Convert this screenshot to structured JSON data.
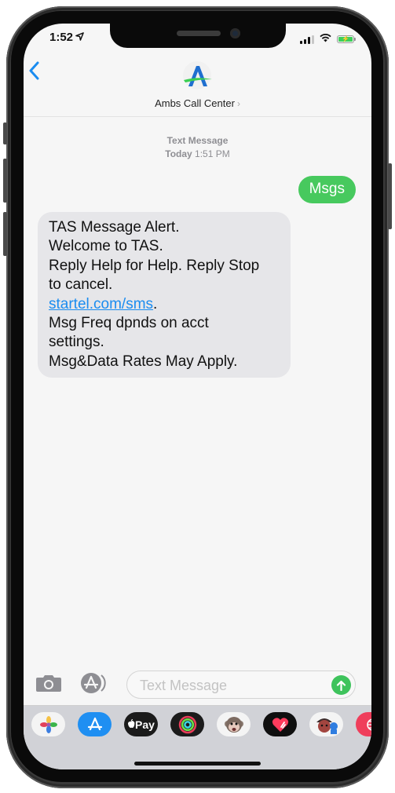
{
  "status_bar": {
    "time": "1:52",
    "location_icon": "location-arrow-icon",
    "signal_icon": "cellular-signal-icon",
    "wifi_icon": "wifi-icon",
    "battery_icon": "battery-charging-icon",
    "battery_charge_glyph": "⚡"
  },
  "header": {
    "back_icon": "chevron-left-icon",
    "back_glyph": "‹",
    "contact_name": "Ambs Call Center",
    "contact_chevron": "›",
    "logo_icon": "ambs-logo-icon"
  },
  "thread": {
    "service_label": "Text Message",
    "date_day": "Today",
    "date_time": "1:51 PM",
    "messages": [
      {
        "direction": "outgoing",
        "text": "Msgs"
      },
      {
        "direction": "incoming",
        "lines": [
          "TAS Message Alert.",
          "Welcome to TAS.",
          "Reply Help for Help. Reply Stop",
          "to cancel."
        ],
        "link_text": "startel.com/sms",
        "link_suffix": ".",
        "lines_after": [
          "Msg Freq dpnds on acct",
          "settings.",
          "Msg&Data Rates May Apply."
        ]
      }
    ]
  },
  "composer": {
    "camera_icon": "camera-icon",
    "apps_icon": "app-store-icon",
    "placeholder": "Text Message",
    "value": "",
    "send_icon": "send-arrow-up-icon"
  },
  "app_tray": {
    "apps": [
      {
        "name": "Photos",
        "icon": "photos-icon"
      },
      {
        "name": "App Store",
        "icon": "app-store-icon"
      },
      {
        "name": "Apple Pay",
        "icon": "apple-pay-icon",
        "label": "Pay"
      },
      {
        "name": "Activity",
        "icon": "activity-rings-icon"
      },
      {
        "name": "Animoji",
        "icon": "animoji-monkey-icon"
      },
      {
        "name": "Digital Touch",
        "icon": "digital-touch-heart-icon"
      },
      {
        "name": "Memoji Stickers",
        "icon": "memoji-stickers-icon"
      },
      {
        "name": "Web Search",
        "icon": "globe-search-icon"
      }
    ]
  },
  "colors": {
    "accent_blue": "#1a8cf0",
    "sent_bubble_green": "#47c95e",
    "received_bubble_gray": "#e6e6e9",
    "send_button_green": "#3ec35c"
  }
}
